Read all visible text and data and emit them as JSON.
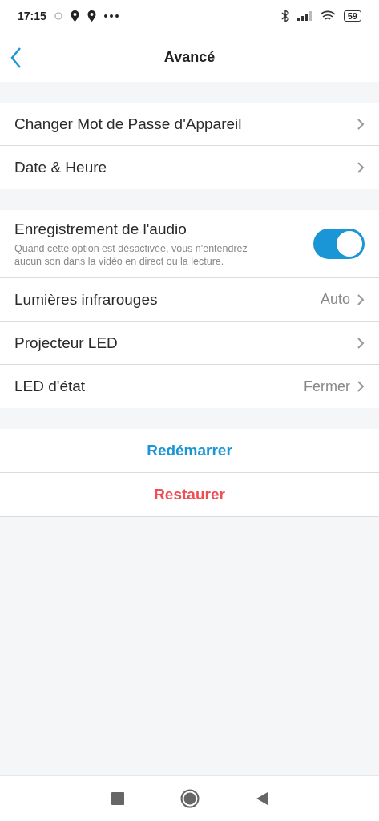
{
  "status_bar": {
    "time": "17:15",
    "battery": "59"
  },
  "header": {
    "title": "Avancé"
  },
  "groups": [
    {
      "items": [
        {
          "kind": "link",
          "label": "Changer Mot de Passe d'Appareil"
        },
        {
          "kind": "link",
          "label": "Date & Heure"
        }
      ]
    },
    {
      "items": [
        {
          "kind": "toggle",
          "label": "Enregistrement de l'audio",
          "description": "Quand cette option est désactivée, vous n'entendrez aucun son dans la vidéo en direct ou la lecture.",
          "on": true
        },
        {
          "kind": "link",
          "label": "Lumières infrarouges",
          "value": "Auto"
        },
        {
          "kind": "link",
          "label": "Projecteur LED"
        },
        {
          "kind": "link",
          "label": "LED d'état",
          "value": "Fermer"
        }
      ]
    }
  ],
  "actions": [
    {
      "kind": "primary",
      "label": "Redémarrer"
    },
    {
      "kind": "danger",
      "label": "Restaurer"
    }
  ]
}
